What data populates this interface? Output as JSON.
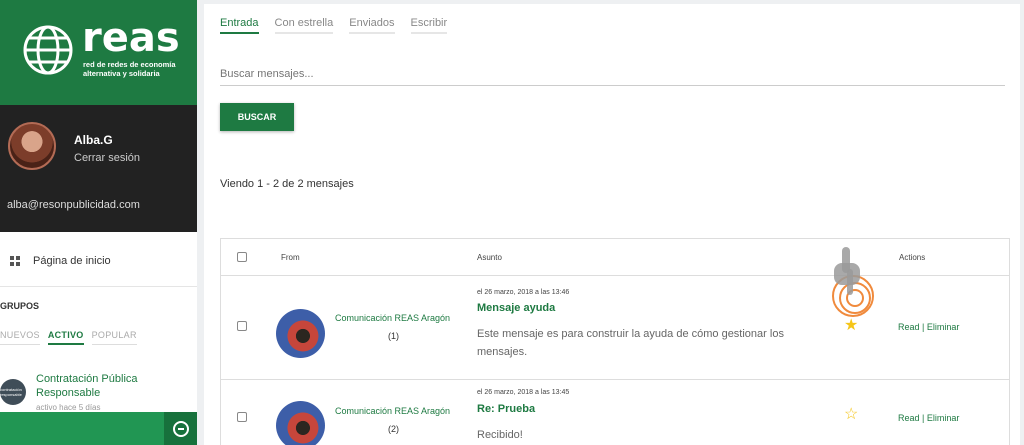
{
  "brand": {
    "name": "reas",
    "subtitle_line1": "red de redes de economía",
    "subtitle_line2": "alternativa y solidaria",
    "color": "#1e7a42"
  },
  "user": {
    "name": "Alba.G",
    "logout": "Cerrar sesión",
    "email": "alba@resonpublicidad.com"
  },
  "nav": {
    "home_label": "Página de inicio",
    "home_icon": "grid-icon"
  },
  "groups": {
    "title": "GRUPOS",
    "tabs": [
      {
        "label": "NUEVOS",
        "active": false
      },
      {
        "label": "ACTIVO",
        "active": true
      },
      {
        "label": "POPULAR",
        "active": false
      }
    ],
    "item": {
      "name": "Contratación Pública Responsable",
      "activity": "activo hace 5 días",
      "avatar_text": "contratación responsable"
    }
  },
  "messages": {
    "tabs": [
      {
        "label": "Entrada",
        "active": true
      },
      {
        "label": "Con estrella",
        "active": false
      },
      {
        "label": "Enviados",
        "active": false
      },
      {
        "label": "Escribir",
        "active": false
      }
    ],
    "search_placeholder": "Buscar mensajes...",
    "search_button": "BUSCAR",
    "count_text": "Viendo 1 - 2 de 2 mensajes",
    "columns": {
      "from": "From",
      "subject": "Asunto",
      "actions": "Actions"
    },
    "rows": [
      {
        "sender": "Comunicación REAS Aragón",
        "thread_count": "(1)",
        "date": "el 26 marzo, 2018 a las 13:46",
        "title": "Mensaje ayuda",
        "body": "Este mensaje es para construir la ayuda de cómo gestionar los mensajes.",
        "starred": true,
        "read_label": "Read",
        "sep": "|",
        "delete_label": "Eliminar"
      },
      {
        "sender": "Comunicación REAS Aragón",
        "thread_count": "(2)",
        "date": "el 26 marzo, 2018 a las 13:45",
        "title": "Re: Prueba",
        "body": "Recibido!",
        "starred": false,
        "read_label": "Read",
        "sep": "|",
        "delete_label": "Eliminar"
      }
    ]
  },
  "chat": {
    "icon": "minus-circle-icon"
  }
}
